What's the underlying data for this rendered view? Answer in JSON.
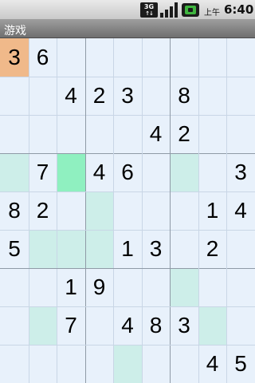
{
  "status_bar": {
    "network_type": "3G",
    "network_arrows": "↑↓",
    "signal_bars": 4,
    "battery_level": 1.0,
    "ampm": "上午",
    "time": "6:40",
    "icons": [
      "network-3g-icon",
      "signal-icon",
      "battery-icon"
    ]
  },
  "titlebar": {
    "title": "游戏"
  },
  "board": {
    "size": 9,
    "colors": {
      "background": "#e8f1fb",
      "selected": "#f0b98a",
      "hint": "#cdeee9",
      "strong": "#8ff0c0",
      "minor_line": "#c9d6e6",
      "major_line": "#8f9aa6"
    },
    "selected": [
      0,
      0
    ],
    "rows": [
      [
        "3",
        "6",
        "",
        "",
        "",
        "",
        "",
        "",
        ""
      ],
      [
        "",
        "",
        "4",
        "2",
        "3",
        "",
        "8",
        "",
        ""
      ],
      [
        "",
        "",
        "",
        "",
        "",
        "4",
        "2",
        "",
        ""
      ],
      [
        "",
        "7",
        "",
        "4",
        "6",
        "",
        "",
        "",
        "3"
      ],
      [
        "8",
        "2",
        "",
        "",
        "",
        "",
        "",
        "1",
        "4"
      ],
      [
        "5",
        "",
        "",
        "",
        "1",
        "3",
        "",
        "2",
        ""
      ],
      [
        "",
        "",
        "1",
        "9",
        "",
        "",
        "",
        "",
        ""
      ],
      [
        "",
        "",
        "7",
        "",
        "4",
        "8",
        "3",
        "",
        ""
      ],
      [
        "",
        "",
        "",
        "",
        "",
        "",
        "",
        "4",
        "5"
      ]
    ],
    "highlights": [
      [
        ".",
        ".",
        ".",
        ".",
        ".",
        ".",
        ".",
        ".",
        "."
      ],
      [
        ".",
        ".",
        ".",
        ".",
        ".",
        ".",
        ".",
        ".",
        "."
      ],
      [
        ".",
        ".",
        ".",
        ".",
        ".",
        ".",
        ".",
        ".",
        "."
      ],
      [
        "h",
        ".",
        "s",
        ".",
        ".",
        ".",
        "h",
        ".",
        "."
      ],
      [
        ".",
        ".",
        ".",
        "h",
        ".",
        ".",
        ".",
        ".",
        "."
      ],
      [
        ".",
        "h",
        "h",
        "h",
        ".",
        ".",
        ".",
        ".",
        "."
      ],
      [
        ".",
        ".",
        ".",
        ".",
        ".",
        ".",
        "h",
        ".",
        "."
      ],
      [
        ".",
        "h",
        ".",
        ".",
        ".",
        ".",
        ".",
        "h",
        "."
      ],
      [
        ".",
        ".",
        ".",
        ".",
        "h",
        ".",
        ".",
        ".",
        "."
      ]
    ]
  }
}
